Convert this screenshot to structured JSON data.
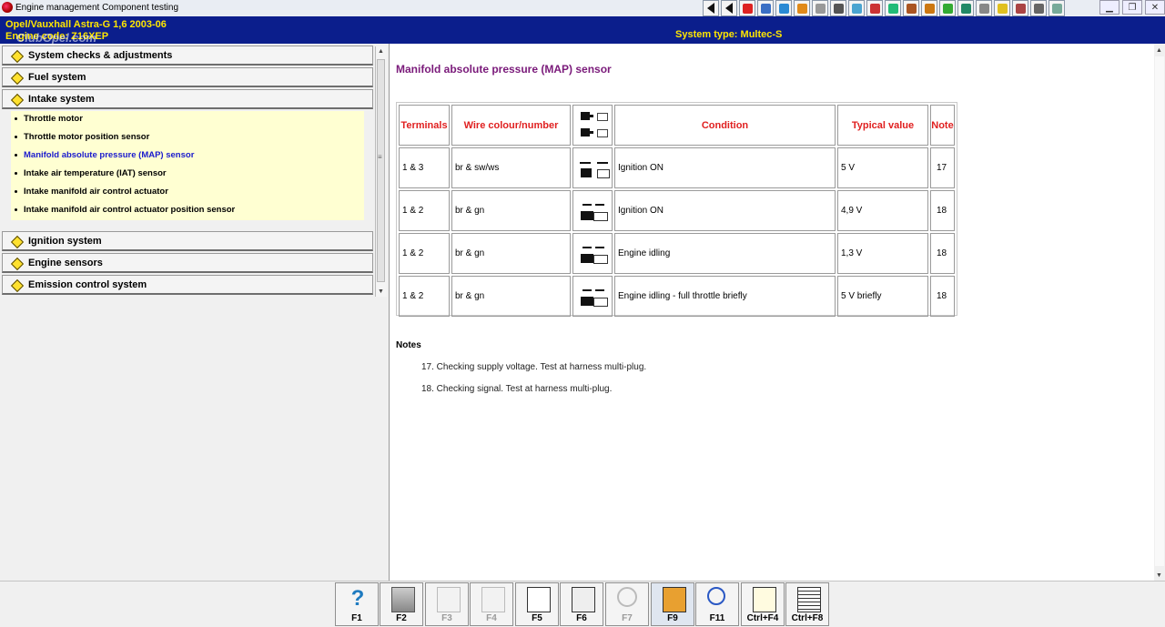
{
  "window": {
    "title": "Engine management Component testing",
    "toolbar_icons": [
      "first-page-icon",
      "previous-icon",
      "warning-icon",
      "print-preview-icon",
      "engine-icon",
      "car-icon",
      "wheel-icon",
      "steering-icon",
      "air-icon",
      "wrench-icon",
      "gauge-icon",
      "battery-icon",
      "tool-icon",
      "parts-icon",
      "oil-icon",
      "fuel-icon",
      "service-icon",
      "a-triangle-icon",
      "car-side-icon",
      "info-icon"
    ],
    "controls": [
      "minimize",
      "restore",
      "close"
    ]
  },
  "header": {
    "line1": "Opel/Vauxhall   Astra-G  1,6  2003-06",
    "line2": "Engine code: Z16XEP",
    "system_type": "System type: Multec-S",
    "watermark": "ClubOpel.com"
  },
  "sidebar": {
    "sections": [
      {
        "label": "System checks & adjustments"
      },
      {
        "label": "Fuel system"
      },
      {
        "label": "Intake system"
      },
      {
        "label": "Ignition system"
      },
      {
        "label": "Engine sensors"
      },
      {
        "label": "Emission control system"
      }
    ],
    "subitems": [
      {
        "label": "Throttle motor"
      },
      {
        "label": "Throttle motor position sensor"
      },
      {
        "label": "Manifold absolute pressure (MAP) sensor",
        "selected": true
      },
      {
        "label": "Intake air temperature (IAT) sensor"
      },
      {
        "label": "Intake manifold air control actuator"
      },
      {
        "label": "Intake manifold air control actuator position sensor"
      }
    ]
  },
  "main": {
    "title": "Manifold absolute pressure (MAP) sensor",
    "table": {
      "headers": [
        "Terminals",
        "Wire colour/number",
        "",
        "Condition",
        "Typical value",
        "Note"
      ],
      "header_icon": "connector-plug-icon",
      "rows": [
        {
          "terminals": "1 & 3",
          "wire": "br & sw/ws",
          "icon": "plug-disconnected-icon",
          "condition": "Ignition ON",
          "value": "5 V",
          "note": "17"
        },
        {
          "terminals": "1 & 2",
          "wire": "br & gn",
          "icon": "plug-connected-icon",
          "condition": "Ignition ON",
          "value": "4,9 V",
          "note": "18"
        },
        {
          "terminals": "1 & 2",
          "wire": "br & gn",
          "icon": "plug-connected-icon",
          "condition": "Engine idling",
          "value": "1,3 V",
          "note": "18"
        },
        {
          "terminals": "1 & 2",
          "wire": "br & gn",
          "icon": "plug-connected-icon",
          "condition": "Engine idling - full throttle briefly",
          "value": "5 V briefly",
          "note": "18"
        }
      ]
    },
    "notes": {
      "heading": "Notes",
      "items": [
        "17. Checking supply voltage. Test at harness multi-plug.",
        "18. Checking signal. Test at harness multi-plug."
      ]
    }
  },
  "function_keys": [
    {
      "key": "F1",
      "icon": "help-icon",
      "enabled": true
    },
    {
      "key": "F2",
      "icon": "printer-icon",
      "enabled": true
    },
    {
      "key": "F3",
      "icon": "document-icon",
      "enabled": false
    },
    {
      "key": "F4",
      "icon": "document-icon",
      "enabled": false
    },
    {
      "key": "F5",
      "icon": "clipboard-icon",
      "enabled": true
    },
    {
      "key": "F6",
      "icon": "calculator-icon",
      "enabled": true
    },
    {
      "key": "F7",
      "icon": "magnifier-icon",
      "enabled": false
    },
    {
      "key": "F9",
      "icon": "dashboard-icon",
      "enabled": true
    },
    {
      "key": "F11",
      "icon": "search-tool-icon",
      "enabled": true
    },
    {
      "key": "Ctrl+F4",
      "icon": "notepad-icon",
      "enabled": true
    },
    {
      "key": "Ctrl+F8",
      "icon": "list-icon",
      "enabled": true
    }
  ],
  "colors": {
    "header_bg": "#0b1e8c",
    "header_text": "#ffe600",
    "accent_red": "#e02020",
    "title_purple": "#7a1a7a",
    "selected_blue": "#1a1acd",
    "subpanel_bg": "#ffffd2"
  }
}
